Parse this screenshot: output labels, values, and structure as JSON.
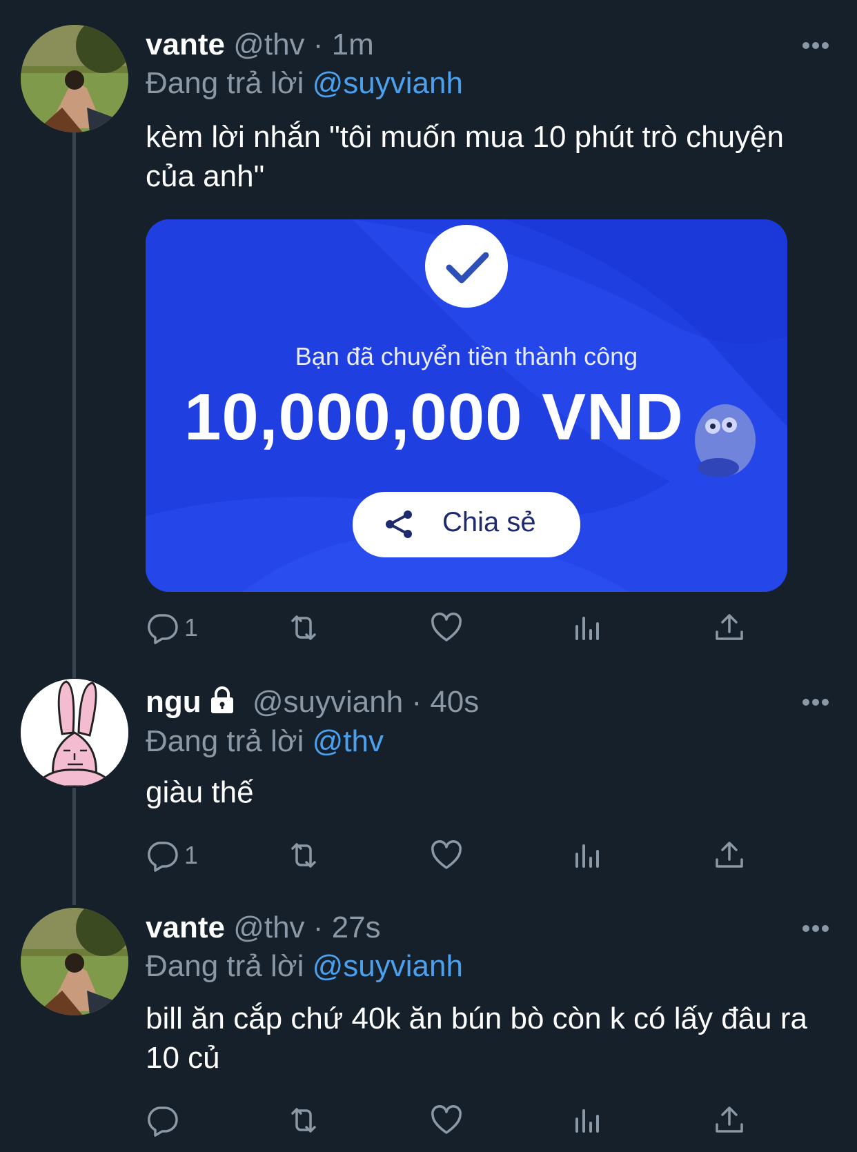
{
  "tweets": [
    {
      "name": "vante",
      "handle": "@thv",
      "time": "1m",
      "replying_label": "Đang trả lời",
      "replying_to": "@suyvianh",
      "text": "kèm lời nhắn \"tôi muốn mua 10 phút trò chuyện của anh\"",
      "reply_count": "1"
    },
    {
      "name": "ngu",
      "handle": "@suyvianh",
      "time": "40s",
      "replying_label": "Đang trả lời",
      "replying_to": "@thv",
      "text": "giàu thế",
      "reply_count": "1"
    },
    {
      "name": "vante",
      "handle": "@thv",
      "time": "27s",
      "replying_label": "Đang trả lời",
      "replying_to": "@suyvianh",
      "text": "bill ăn cắp chứ 40k ăn bún bò còn k có lấy đâu ra 10 củ",
      "reply_count": ""
    }
  ],
  "media": {
    "message": "Bạn đã chuyển tiền thành công",
    "amount": "10,000,000 VND",
    "share_label": "Chia sẻ"
  },
  "separator": "·",
  "colors": {
    "background": "#15202b",
    "muted": "#8b98a5",
    "link": "#4ca0ec",
    "media_blue": "#1f3fe0"
  },
  "icons": [
    "reply-icon",
    "retweet-icon",
    "like-icon",
    "analytics-icon",
    "share-icon",
    "more-icon",
    "lock-icon",
    "check-icon"
  ]
}
